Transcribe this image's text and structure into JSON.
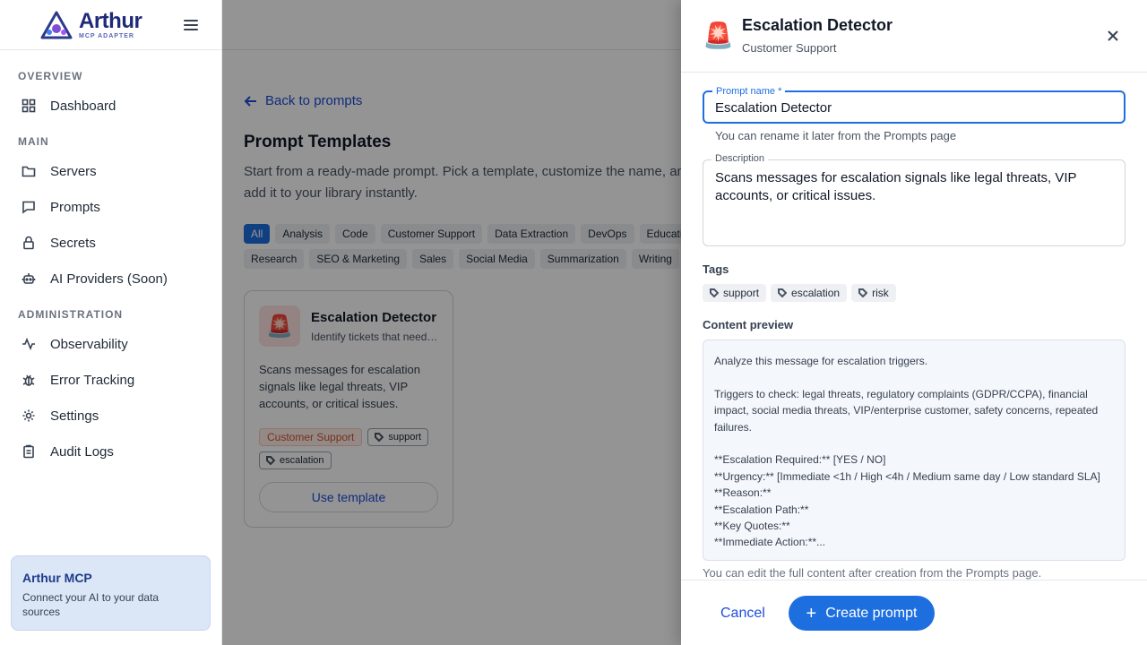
{
  "brand": {
    "name": "Arthur",
    "sub": "MCP ADAPTER"
  },
  "sidebar": {
    "sections": [
      {
        "label": "OVERVIEW",
        "items": [
          {
            "label": "Dashboard",
            "icon": "dashboard-icon"
          }
        ]
      },
      {
        "label": "MAIN",
        "items": [
          {
            "label": "Servers",
            "icon": "folder-icon"
          },
          {
            "label": "Prompts",
            "icon": "chat-icon"
          },
          {
            "label": "Secrets",
            "icon": "lock-icon"
          },
          {
            "label": "AI Providers (Soon)",
            "icon": "robot-icon"
          }
        ]
      },
      {
        "label": "ADMINISTRATION",
        "items": [
          {
            "label": "Observability",
            "icon": "pulse-icon"
          },
          {
            "label": "Error Tracking",
            "icon": "bug-icon"
          },
          {
            "label": "Settings",
            "icon": "gear-icon"
          },
          {
            "label": "Audit Logs",
            "icon": "clipboard-icon"
          }
        ]
      }
    ],
    "promo": {
      "title": "Arthur MCP",
      "text": "Connect your AI to your data sources"
    }
  },
  "main": {
    "back": "Back to prompts",
    "title": "Prompt Templates",
    "description": "Start from a ready-made prompt. Pick a template, customize the name, and add it to your library instantly.",
    "categories": [
      "All",
      "Analysis",
      "Code",
      "Customer Support",
      "Data Extraction",
      "DevOps",
      "Education",
      "Research",
      "SEO & Marketing",
      "Sales",
      "Social Media",
      "Summarization",
      "Writing"
    ],
    "card": {
      "emoji": "🚨",
      "title": "Escalation Detector",
      "subtitle": "Identify tickets that need escalation",
      "description": "Scans messages for escalation signals like legal threats, VIP accounts, or critical issues.",
      "category": "Customer Support",
      "tags": [
        "support",
        "escalation"
      ],
      "button": "Use template"
    }
  },
  "drawer": {
    "emoji": "🚨",
    "title": "Escalation Detector",
    "subtitle": "Customer Support",
    "name_label": "Prompt name *",
    "name_value": "Escalation Detector",
    "name_helper": "You can rename it later from the Prompts page",
    "desc_label": "Description",
    "desc_value": "Scans messages for escalation signals like legal threats, VIP accounts, or critical issues.",
    "tags_label": "Tags",
    "tags": [
      "support",
      "escalation",
      "risk"
    ],
    "preview_label": "Content preview",
    "preview": "Analyze this message for escalation triggers.\n\nTriggers to check: legal threats, regulatory complaints (GDPR/CCPA), financial impact, social media threats, VIP/enterprise customer, safety concerns, repeated failures.\n\n**Escalation Required:** [YES / NO]\n**Urgency:** [Immediate <1h / High <4h / Medium same day / Low standard SLA]\n**Reason:**\n**Escalation Path:**\n**Key Quotes:**\n**Immediate Action:**...",
    "preview_helper": "You can edit the full content after creation from the Prompts page.",
    "cancel": "Cancel",
    "create": "Create prompt"
  }
}
